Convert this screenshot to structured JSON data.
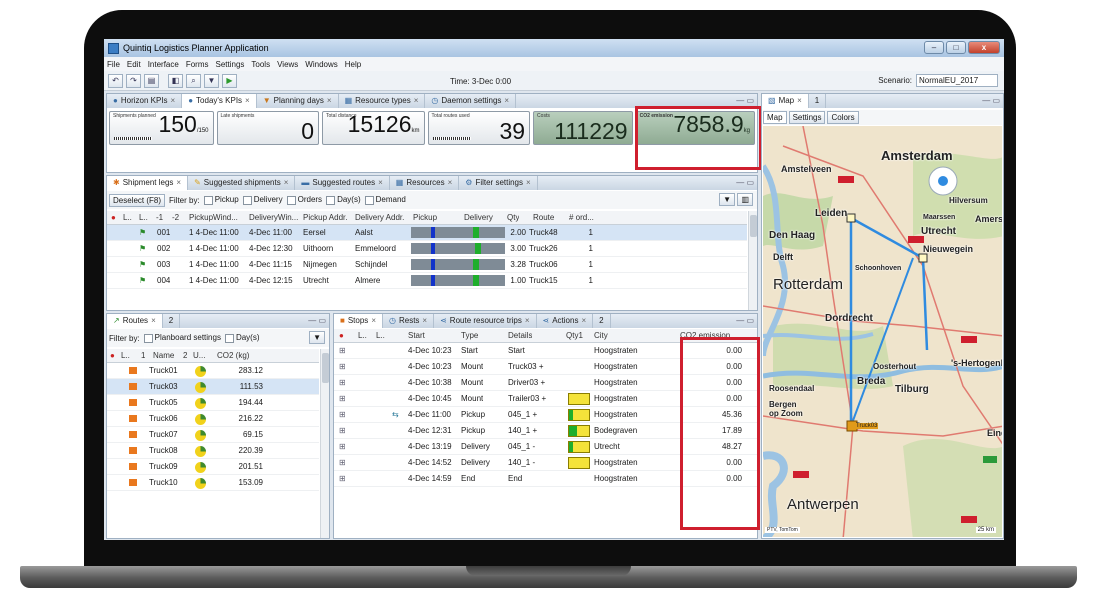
{
  "window": {
    "title": "Quintiq Logistics Planner Application",
    "minimize": "–",
    "maximize": "□",
    "close": "x"
  },
  "menu": [
    "File",
    "Edit",
    "Interface",
    "Forms",
    "Settings",
    "Tools",
    "Views",
    "Windows",
    "Help"
  ],
  "toolbar": {
    "time": "Time: 3-Dec 0:00",
    "scenario_label": "Scenario:",
    "scenario_value": "NormalEU_2017"
  },
  "kpi_panel": {
    "tabs": [
      "Horizon KPIs",
      "Today's KPIs",
      "Planning days",
      "Resource types",
      "Daemon settings"
    ],
    "kpis": [
      {
        "label": "Shipments planned",
        "value": "150",
        "unit": "/150"
      },
      {
        "label": "Late shipments",
        "value": "0",
        "unit": ""
      },
      {
        "label": "Total distance",
        "value": "15126",
        "unit": "km"
      },
      {
        "label": "Total routes used",
        "value": "39",
        "unit": ""
      },
      {
        "label": "Costs",
        "value": "111229",
        "unit": ""
      },
      {
        "label": "CO2 emission",
        "value": "7858.9",
        "unit": "kg"
      }
    ]
  },
  "shipments_panel": {
    "tabs": [
      "Shipment legs",
      "Suggested shipments",
      "Suggested routes",
      "Resources",
      "Filter settings"
    ],
    "deselect": "Deselect (F8)",
    "filter_by": "Filter by:",
    "filters": [
      "Pickup",
      "Delivery",
      "Orders",
      "Day(s)",
      "Demand"
    ],
    "headers": [
      "L..",
      "L..",
      "-1",
      "-2",
      "PickupWind...",
      "DeliveryWin...",
      "Pickup Addr.",
      "Delivery Addr.",
      "Pickup",
      "Delivery",
      "Qty",
      "Route",
      "# ord..."
    ],
    "rows": [
      {
        "id": "001",
        "pw": "1 4-Dec 11:00",
        "dw": "4-Dec 11:00",
        "pa": "Eersel",
        "da": "Aalst",
        "qty": "2.00",
        "route": "Truck48",
        "ord": "1"
      },
      {
        "id": "002",
        "pw": "1 4-Dec 11:00",
        "dw": "4-Dec 12:30",
        "pa": "Uithoorn",
        "da": "Emmeloord",
        "qty": "3.00",
        "route": "Truck26",
        "ord": "1"
      },
      {
        "id": "003",
        "pw": "1 4-Dec 11:00",
        "dw": "4-Dec 11:15",
        "pa": "Nijmegen",
        "da": "Schijndel",
        "qty": "3.28",
        "route": "Truck06",
        "ord": "1"
      },
      {
        "id": "004",
        "pw": "1 4-Dec 11:00",
        "dw": "4-Dec 12:15",
        "pa": "Utrecht",
        "da": "Almere",
        "qty": "1.00",
        "route": "Truck15",
        "ord": "1"
      }
    ]
  },
  "routes_panel": {
    "tabs": [
      "Routes",
      "2"
    ],
    "filter_by": "Filter by:",
    "filters": [
      "Planboard settings",
      "Day(s)"
    ],
    "headers": [
      "L..",
      "1",
      "Name",
      "2",
      "U...",
      "CO2 (kg)"
    ],
    "rows": [
      {
        "name": "Truck01",
        "co2": "283.12"
      },
      {
        "name": "Truck03",
        "co2": "111.53"
      },
      {
        "name": "Truck05",
        "co2": "194.44"
      },
      {
        "name": "Truck06",
        "co2": "216.22"
      },
      {
        "name": "Truck07",
        "co2": "69.15"
      },
      {
        "name": "Truck08",
        "co2": "220.39"
      },
      {
        "name": "Truck09",
        "co2": "201.51"
      },
      {
        "name": "Truck10",
        "co2": "153.09"
      }
    ]
  },
  "stops_panel": {
    "tabs": [
      "Stops",
      "Rests",
      "Route resource trips",
      "Actions",
      "2"
    ],
    "headers": [
      "L..",
      "L..",
      "Start",
      "Type",
      "Details",
      "Qty1",
      "City",
      "CO2 emission ..."
    ],
    "rows": [
      {
        "start": "4-Dec 10:23",
        "type": "Start",
        "details": "Start",
        "city": "Hoogstraten",
        "co2": "0.00",
        "load": null
      },
      {
        "start": "4-Dec 10:23",
        "type": "Mount",
        "details": "Truck03 +",
        "city": "Hoogstraten",
        "co2": "0.00",
        "load": null
      },
      {
        "start": "4-Dec 10:38",
        "type": "Mount",
        "details": "Driver03 +",
        "city": "Hoogstraten",
        "co2": "0.00",
        "load": null
      },
      {
        "start": "4-Dec 10:45",
        "type": "Mount",
        "details": "Trailer03 +",
        "city": "Hoogstraten",
        "co2": "0.00",
        "load": 0
      },
      {
        "start": "4-Dec 11:00",
        "type": "Pickup",
        "details": "045_1 +",
        "city": "Hoogstraten",
        "co2": "45.36",
        "load": 0.2
      },
      {
        "start": "4-Dec 12:31",
        "type": "Pickup",
        "details": "140_1 +",
        "city": "Bodegraven",
        "co2": "17.89",
        "load": 0.4
      },
      {
        "start": "4-Dec 13:19",
        "type": "Delivery",
        "details": "045_1 -",
        "city": "Utrecht",
        "co2": "48.27",
        "load": 0.2
      },
      {
        "start": "4-Dec 14:52",
        "type": "Delivery",
        "details": "140_1 -",
        "city": "Hoogstraten",
        "co2": "0.00",
        "load": 0
      },
      {
        "start": "4-Dec 14:59",
        "type": "End",
        "details": "End",
        "city": "Hoogstraten",
        "co2": "0.00",
        "load": null
      }
    ]
  },
  "map_panel": {
    "tabs": [
      "Map",
      "1"
    ],
    "subtabs": [
      "Map",
      "Settings",
      "Colors"
    ],
    "cities": [
      "Amsterdam",
      "Amstelveen",
      "Leiden",
      "Den Haag",
      "Delft",
      "Rotterdam",
      "Dordrecht",
      "Utrecht",
      "Nieuwegein",
      "Schoonhoven",
      "Hilversum",
      "Maarssen",
      "Amersfoort",
      "Breda",
      "Tilburg",
      "Roosendaal",
      "Bergen op Zoom",
      "Oosterhout",
      "'s-Hertogenbosch",
      "Antwerpen",
      "Eindhoven"
    ],
    "route_label": "Truck03",
    "scale": "25 km",
    "copyright": "PTV, TomTom"
  },
  "colors": {
    "highlight": "#cf1f2e",
    "kpi_green": "#9fb9a3",
    "route_blue": "#2f8be0"
  }
}
